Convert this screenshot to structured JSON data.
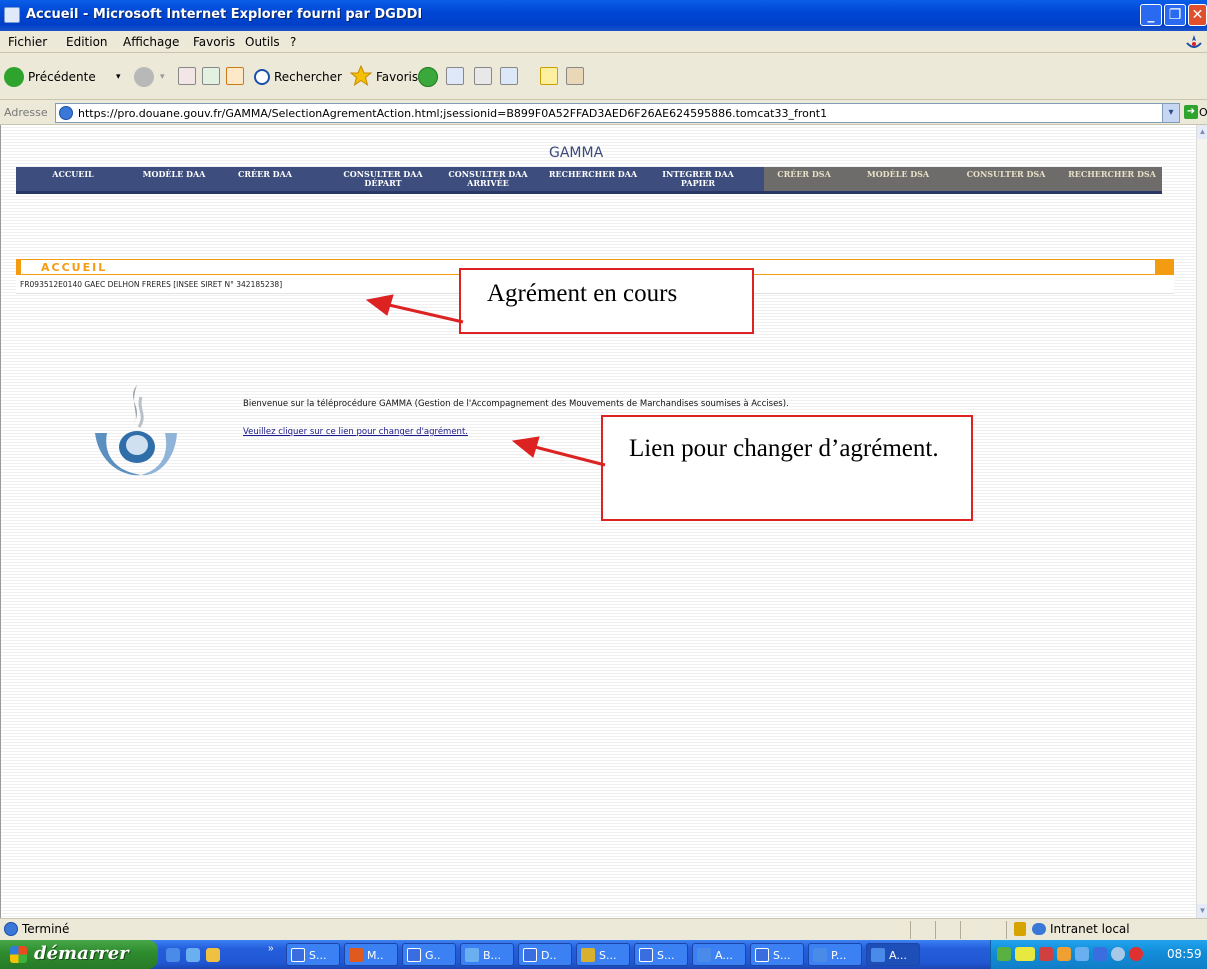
{
  "window": {
    "title": "Accueil - Microsoft Internet Explorer fourni par DGDDI",
    "buttons": [
      "minimize-icon",
      "maximize-icon",
      "close-icon"
    ]
  },
  "menu": [
    "Fichier",
    "Edition",
    "Affichage",
    "Favoris",
    "Outils",
    "?"
  ],
  "toolbar": {
    "back_label": "Précédente",
    "search_label": "Rechercher",
    "favorites_label": "Favoris"
  },
  "address": {
    "label": "Adresse",
    "url": "https://pro.douane.gouv.fr/GAMMA/SelectionAgrementAction.html;jsessionid=B899F0A52FFAD3AED6F26AE624595886.tomcat33_front1",
    "go_label": "OK"
  },
  "page": {
    "app_title": "GAMMA",
    "nav": [
      "ACCUEIL",
      "MODÈLE DAA",
      "CRÉER DAA",
      "CONSULTER DAA DÉPART",
      "CONSULTER DAA ARRIVÉE",
      "RECHERCHER DAA",
      "INTEGRER DAA PAPIER",
      "CRÉER DSA",
      "MODÈLE DSA",
      "CONSULTER DSA",
      "RECHERCHER DSA"
    ],
    "section_title": "ACCUEIL",
    "agrement": "FR093512E0140 GAEC DELHON FRERES [INSEE SIRET N° 342185238]",
    "welcome": "Bienvenue sur la téléprocédure GAMMA (Gestion de l'Accompagnement des Mouvements de Marchandises soumises à Accises).",
    "change_link": "Veuillez cliquer sur ce lien pour changer d'agrément."
  },
  "annotations": {
    "callout1": "Agrément en cours",
    "callout2": "Lien pour changer d’agrément.",
    "color": "#dd2222"
  },
  "status": {
    "text": "Terminé",
    "zone": "Intranet local"
  },
  "taskbar": {
    "start": "démarrer",
    "tasks": [
      "S...",
      "M..",
      "G..",
      "B...",
      "D..",
      "S...",
      "S...",
      "A...",
      "S...",
      "P...",
      "A..."
    ],
    "clock": "08:59"
  }
}
